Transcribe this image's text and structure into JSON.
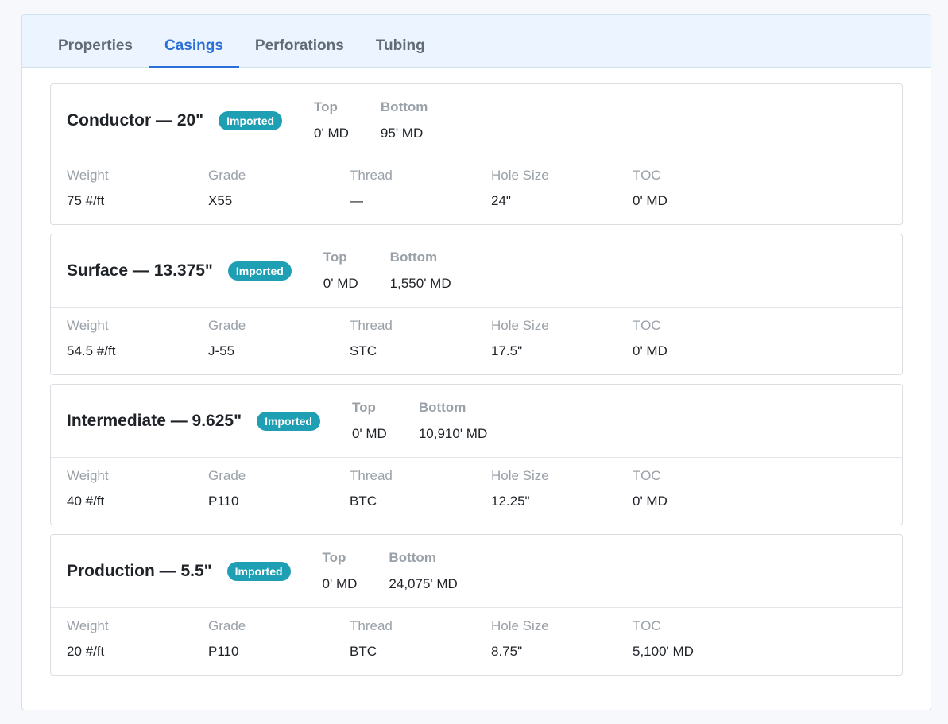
{
  "tabs": [
    {
      "label": "Properties"
    },
    {
      "label": "Casings"
    },
    {
      "label": "Perforations"
    },
    {
      "label": "Tubing"
    }
  ],
  "field_labels": {
    "top": "Top",
    "bottom": "Bottom",
    "weight": "Weight",
    "grade": "Grade",
    "thread": "Thread",
    "hole_size": "Hole Size",
    "toc": "TOC"
  },
  "casings": [
    {
      "title": "Conductor — 20\"",
      "badge": "Imported",
      "top": "0' MD",
      "bottom": "95' MD",
      "weight": "75 #/ft",
      "grade": "X55",
      "thread": "—",
      "hole_size": "24\"",
      "toc": "0' MD"
    },
    {
      "title": "Surface — 13.375\"",
      "badge": "Imported",
      "top": "0' MD",
      "bottom": "1,550' MD",
      "weight": "54.5 #/ft",
      "grade": "J-55",
      "thread": "STC",
      "hole_size": "17.5\"",
      "toc": "0' MD"
    },
    {
      "title": "Intermediate — 9.625\"",
      "badge": "Imported",
      "top": "0' MD",
      "bottom": "10,910' MD",
      "weight": "40 #/ft",
      "grade": "P110",
      "thread": "BTC",
      "hole_size": "12.25\"",
      "toc": "0' MD"
    },
    {
      "title": "Production — 5.5\"",
      "badge": "Imported",
      "top": "0' MD",
      "bottom": "24,075' MD",
      "weight": "20 #/ft",
      "grade": "P110",
      "thread": "BTC",
      "hole_size": "8.75\"",
      "toc": "5,100' MD"
    }
  ],
  "colors": {
    "accent": "#2b6fd6",
    "badge": "#1f9fb3"
  }
}
